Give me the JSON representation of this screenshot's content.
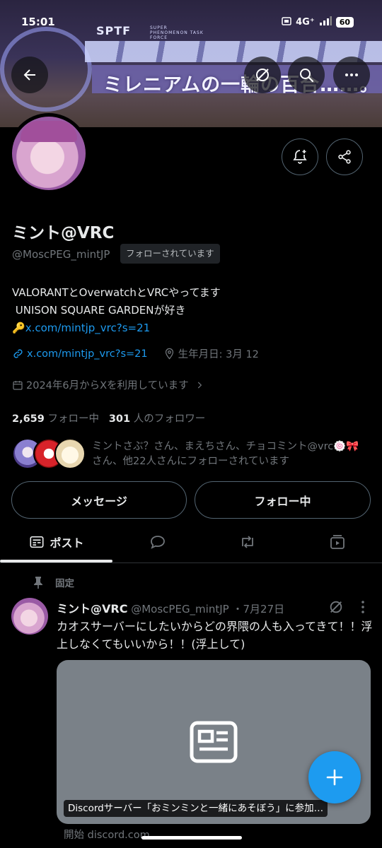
{
  "status_bar": {
    "time": "15:01",
    "network": "4G⁺",
    "battery": "60"
  },
  "banner": {
    "brand": "SPTF",
    "brand_sub": "SUPER PHENOMENON TASK FORCE",
    "slogan": "ミレニアムの一輪の百合……。"
  },
  "header": {
    "back_icon": "arrow-left-icon",
    "grok_icon": "grok-icon",
    "search_icon": "search-icon",
    "more_icon": "more-horizontal-icon"
  },
  "profile": {
    "name": "ミント@VRC",
    "handle": "@MoscPEG_mintJP",
    "follows_you": "フォローされています",
    "bio_line1": "VALORANTとOverwatchとVRCやってます",
    "bio_line2": " UNISON SQUARE GARDENが好き",
    "bio_link_emoji": "🔑",
    "bio_link": "x.com/mintjp_vrc?s=21",
    "website": "x.com/mintjp_vrc?s=21",
    "birthday": "生年月日: 3月 12",
    "joined": "2024年6月からXを利用しています",
    "following_count": "2,659",
    "following_label": "フォロー中",
    "followers_count": "301",
    "followers_label": "人のフォロワー",
    "followed_by": "ミントさぶ？さん、まえちさん、チョコミント@vrc🍥🎀さん、他22人さんにフォローされています",
    "message_button": "メッセージ",
    "following_button": "フォロー中"
  },
  "tabs": [
    {
      "label": "ポスト",
      "icon": "posts-icon"
    },
    {
      "label": "",
      "icon": "replies-icon"
    },
    {
      "label": "",
      "icon": "repost-icon"
    },
    {
      "label": "",
      "icon": "media-icon"
    }
  ],
  "pinned_post": {
    "pinned_label": "固定",
    "author": "ミント@VRC",
    "handle": "@MoscPEG_mintJP",
    "date": "・7月27日",
    "text": "カオスサーバーにしたいからどの界隈の人も入ってきて！！浮上しなくてもいいから！！(浮上して)",
    "card_caption": "Discordサーバー「おミンミンと一緒にあそぼう」に参加…",
    "card_domain": "開始 discord.com"
  },
  "colors": {
    "accent": "#1d9bf0",
    "background": "#000000",
    "muted": "#71767b",
    "text": "#e7e9ea"
  }
}
